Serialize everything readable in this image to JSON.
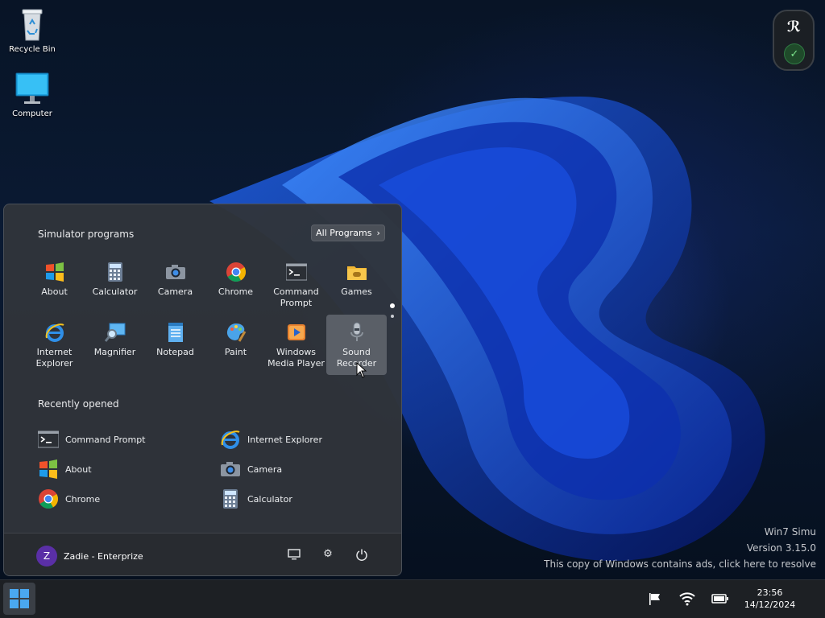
{
  "desktop": {
    "icons": [
      {
        "label": "Recycle Bin",
        "icon": "recycle-bin-icon"
      },
      {
        "label": "Computer",
        "icon": "computer-icon"
      }
    ]
  },
  "start_menu": {
    "programs_title": "Simulator programs",
    "all_programs_label": "All Programs",
    "programs": [
      {
        "label": "About",
        "icon": "windows-logo-icon"
      },
      {
        "label": "Calculator",
        "icon": "calculator-icon"
      },
      {
        "label": "Camera",
        "icon": "camera-icon"
      },
      {
        "label": "Chrome",
        "icon": "chrome-icon"
      },
      {
        "label": "Command Prompt",
        "icon": "command-prompt-icon"
      },
      {
        "label": "Games",
        "icon": "games-folder-icon"
      },
      {
        "label": "Internet Explorer",
        "icon": "internet-explorer-icon"
      },
      {
        "label": "Magnifier",
        "icon": "magnifier-icon"
      },
      {
        "label": "Notepad",
        "icon": "notepad-icon"
      },
      {
        "label": "Paint",
        "icon": "paint-icon"
      },
      {
        "label": "Windows Media Player",
        "icon": "media-player-icon"
      },
      {
        "label": "Sound Recorder",
        "icon": "sound-recorder-icon"
      }
    ],
    "recent_title": "Recently opened",
    "recent": [
      {
        "label": "Command Prompt",
        "icon": "command-prompt-icon"
      },
      {
        "label": "Internet Explorer",
        "icon": "internet-explorer-icon"
      },
      {
        "label": "About",
        "icon": "windows-logo-icon"
      },
      {
        "label": "Camera",
        "icon": "camera-icon"
      },
      {
        "label": "Chrome",
        "icon": "chrome-icon"
      },
      {
        "label": "Calculator",
        "icon": "calculator-icon"
      }
    ],
    "user": {
      "initial": "Z",
      "name": "Zadie - Enterprize"
    }
  },
  "watermark": {
    "line1": "Win7 Simu",
    "line2": "Version 3.15.0",
    "line3": "This copy of Windows contains ads, click here to resolve"
  },
  "taskbar": {
    "time": "23:56",
    "date": "14/12/2024"
  },
  "colors": {
    "accent": "#2f7bd8",
    "menu_bg": "#30343a",
    "taskbar_bg": "#1d2024",
    "avatar": "#5a2fa6"
  }
}
